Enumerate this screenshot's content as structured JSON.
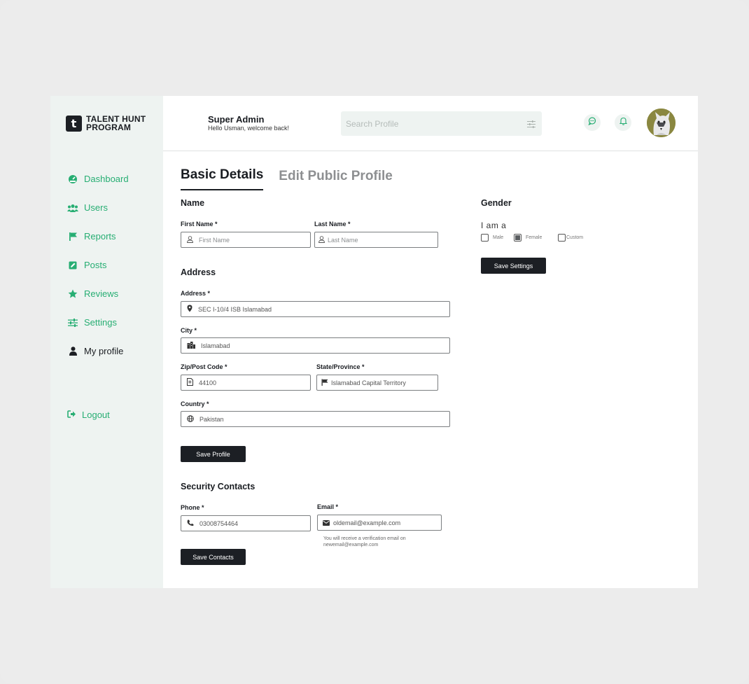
{
  "brand": {
    "logo_letter": "t",
    "line1": "TALENT HUNT",
    "line2": "PROGRAM",
    "accent": "#27ae73",
    "dark": "#1c1f24"
  },
  "sidebar": {
    "items": [
      {
        "label": "Dashboard",
        "icon": "dashboard-icon"
      },
      {
        "label": "Users",
        "icon": "users-icon"
      },
      {
        "label": "Reports",
        "icon": "flag-icon"
      },
      {
        "label": "Posts",
        "icon": "edit-icon"
      },
      {
        "label": "Reviews",
        "icon": "star-icon"
      },
      {
        "label": "Settings",
        "icon": "sliders-icon"
      },
      {
        "label": "My profile",
        "icon": "user-icon"
      }
    ],
    "logout": "Logout"
  },
  "header": {
    "title": "Super Admin",
    "subtitle": "Hello Usman, welcome back!",
    "search_placeholder": "Search Profile"
  },
  "tabs": {
    "active": "Basic Details",
    "inactive": "Edit Public Profile"
  },
  "name_section": {
    "title": "Name",
    "first_label": "First Name *",
    "first_placeholder": "First Name",
    "last_label": "Last Name *",
    "last_placeholder": "Last Name"
  },
  "address_section": {
    "title": "Address",
    "address_label": "Address *",
    "address_value": "SEC I-10/4 ISB Islamabad",
    "city_label": "City *",
    "city_value": "Islamabad",
    "zip_label": "Zip/Post Code *",
    "zip_value": "44100",
    "state_label": "State/Province *",
    "state_value": "Islamabad Capital Territory",
    "country_label": "Country *",
    "country_value": "Pakistan",
    "save_label": "Save Profile"
  },
  "security_section": {
    "title": "Security Contacts",
    "phone_label": "Phone *",
    "phone_value": "03008754464",
    "email_label": "Email *",
    "email_value": "oldemail@example.com",
    "email_note": "You will receive a verification email on newemail@example.com",
    "save_label": "Save Contacts"
  },
  "gender_section": {
    "title": "Gender",
    "prompt": "I am a",
    "options": [
      {
        "label": "Male",
        "checked": false
      },
      {
        "label": "Female",
        "checked": true
      },
      {
        "label": "Custom",
        "checked": false
      }
    ],
    "save_label": "Save Settings"
  }
}
